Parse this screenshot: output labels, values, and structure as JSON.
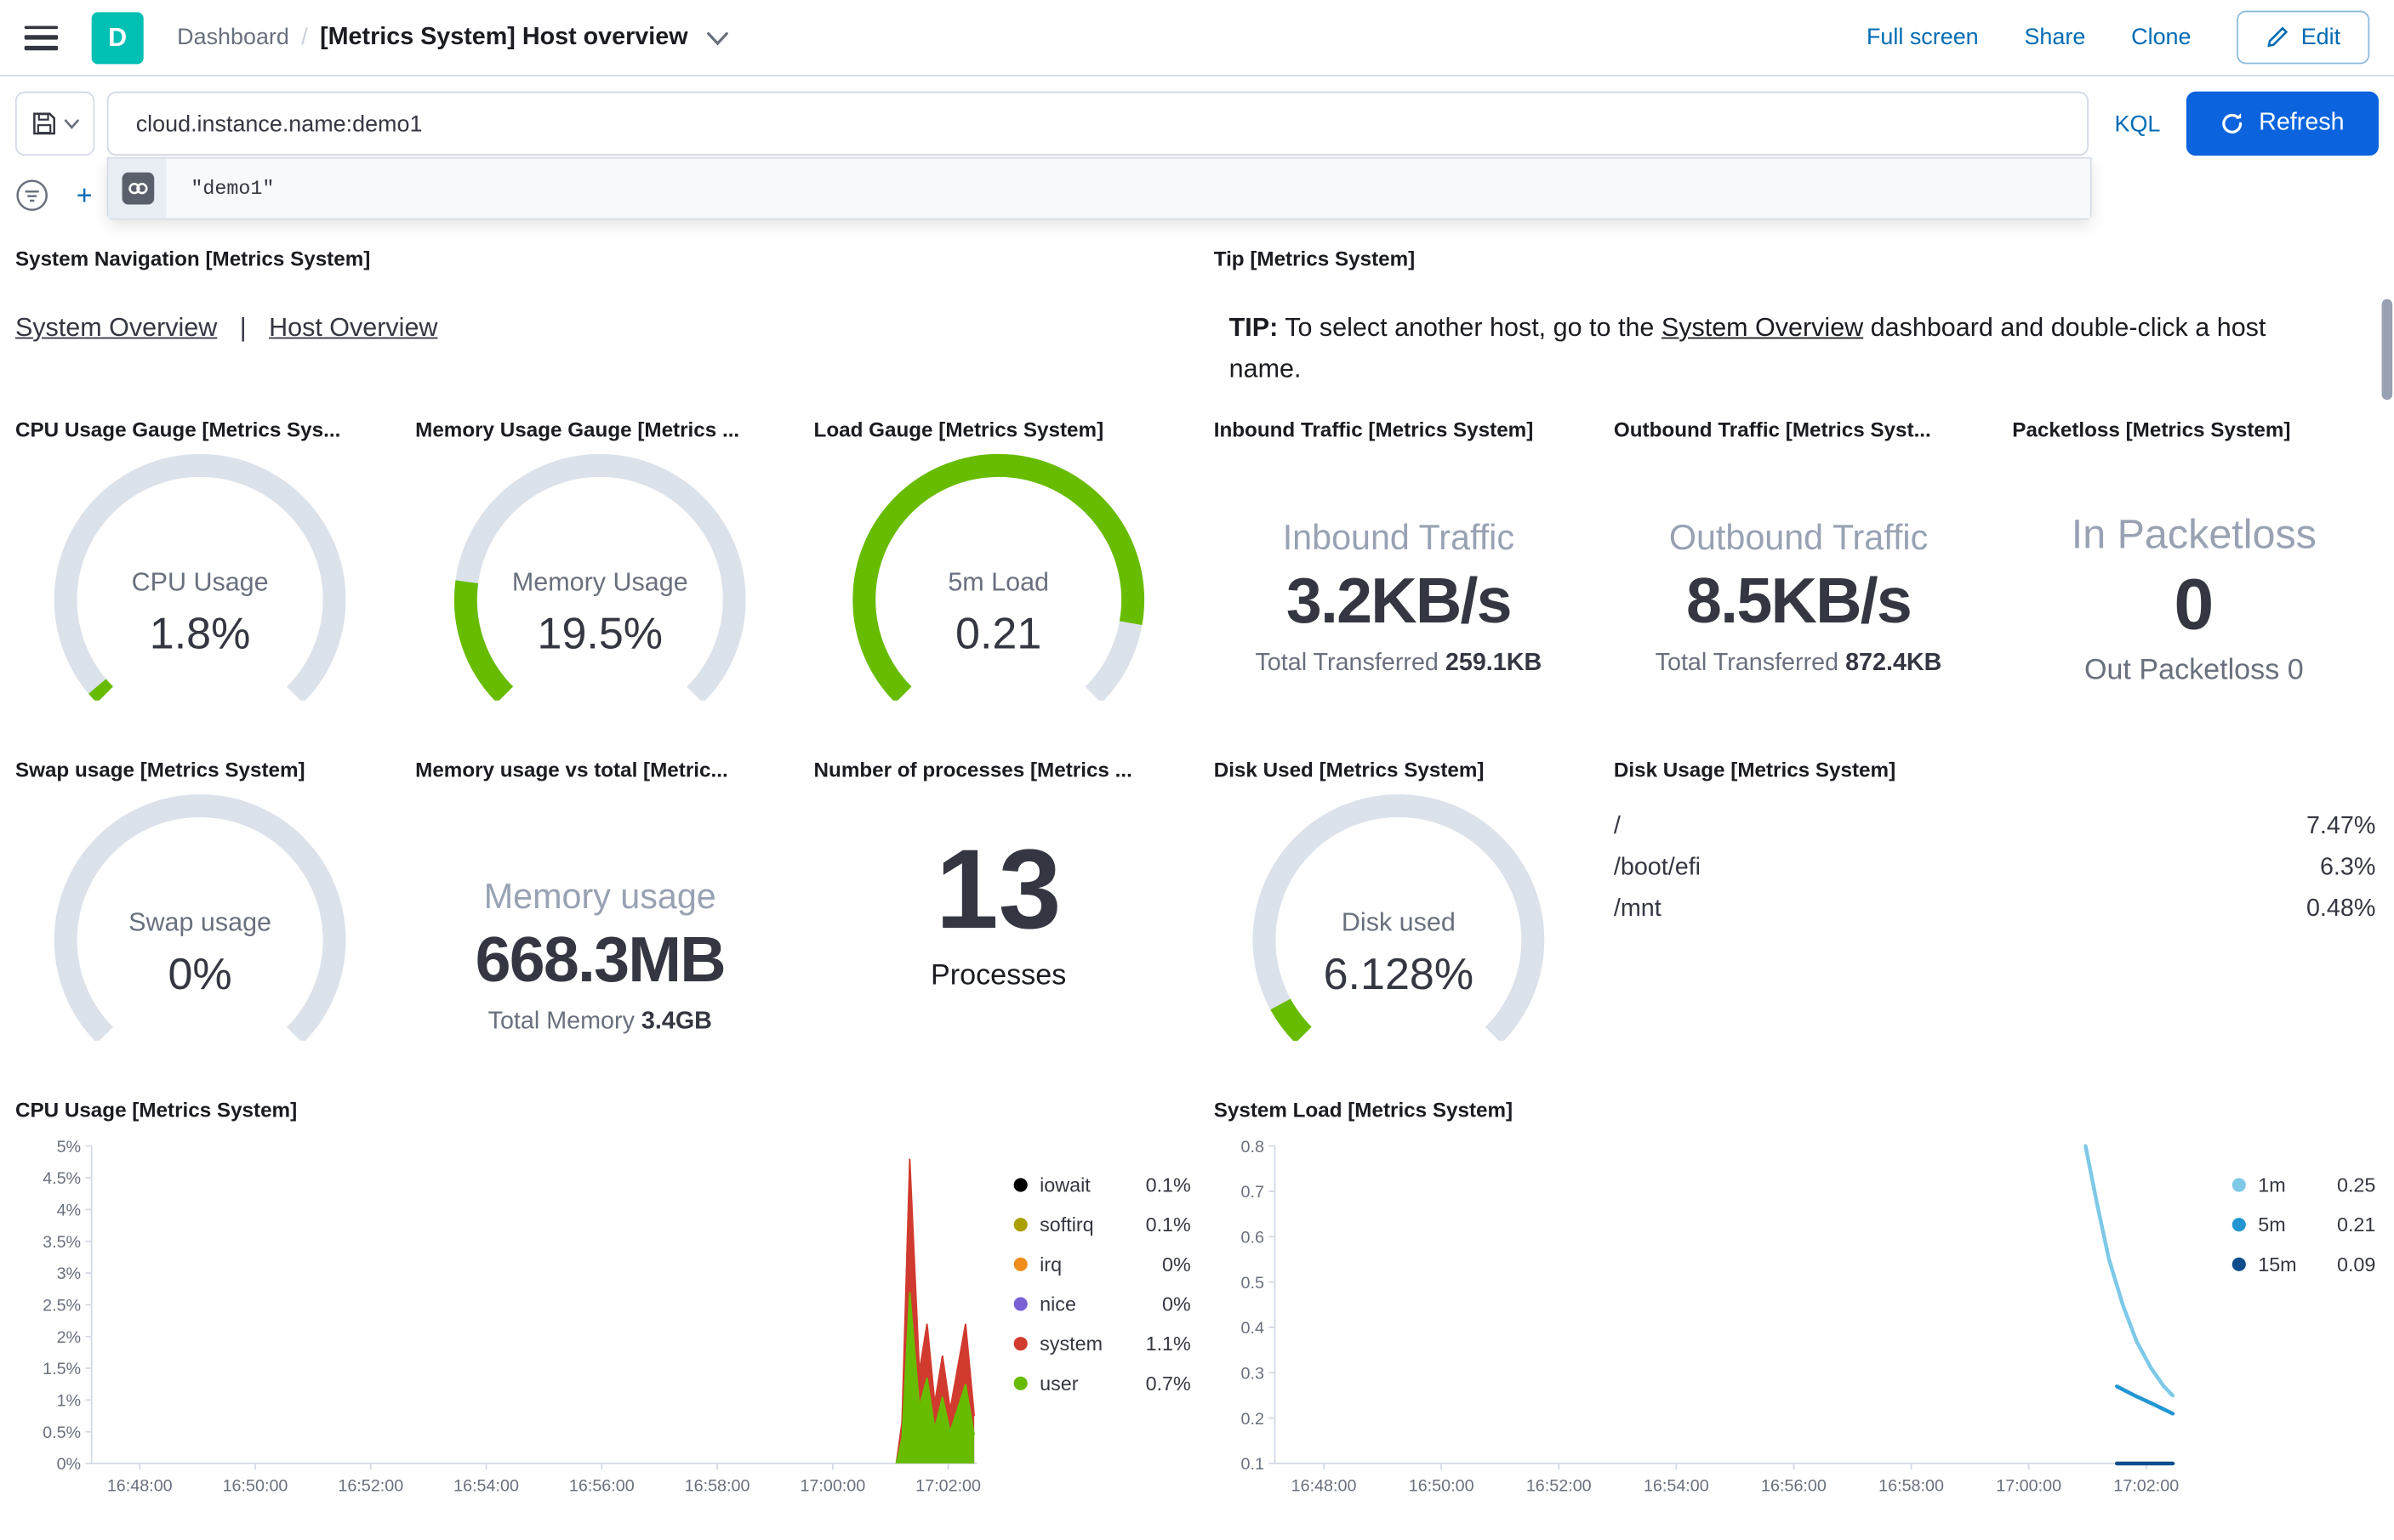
{
  "colors": {
    "primary_button": "#0B64DD",
    "link_blue": "#006BB4",
    "green": "#68BC00",
    "red": "#D13A2E",
    "logo_teal": "#00BFB3",
    "gauge_track": "#DCE2EA"
  },
  "header": {
    "logo_letter": "D",
    "breadcrumb_root": "Dashboard",
    "title": "[Metrics System] Host overview",
    "actions": [
      "Full screen",
      "Share",
      "Clone"
    ],
    "edit_label": "Edit"
  },
  "query_bar": {
    "query": "cloud.instance.name:demo1",
    "language": "KQL",
    "refresh_label": "Refresh",
    "suggestion": "\"demo1\""
  },
  "panels": {
    "sysnav": {
      "title": "System Navigation [Metrics System]",
      "links": [
        "System Overview",
        "Host Overview"
      ],
      "separator": "|"
    },
    "tip": {
      "title": "Tip [Metrics System]",
      "bold": "TIP:",
      "pre": " To select another host, go to the ",
      "link": "System Overview",
      "post": " dashboard and double-click a host name."
    },
    "cpu_gauge": {
      "title": "CPU Usage Gauge [Metrics Sys..."
    },
    "mem_gauge": {
      "title": "Memory Usage Gauge [Metrics ..."
    },
    "load_gauge": {
      "title": "Load Gauge [Metrics System]"
    },
    "inbound": {
      "title": "Inbound Traffic [Metrics System]"
    },
    "outbound": {
      "title": "Outbound Traffic [Metrics Syst..."
    },
    "packetloss": {
      "title": "Packetloss [Metrics System]"
    },
    "swap": {
      "title": "Swap usage [Metrics System]"
    },
    "memtotal": {
      "title": "Memory usage vs total [Metric..."
    },
    "processes": {
      "title": "Number of processes [Metrics ..."
    },
    "disk_used": {
      "title": "Disk Used [Metrics System]"
    },
    "disk_usage": {
      "title": "Disk Usage [Metrics System]"
    },
    "cpu_chart": {
      "title": "CPU Usage [Metrics System]"
    },
    "load_chart": {
      "title": "System Load [Metrics System]"
    }
  },
  "gauges": [
    {
      "id": "cpu",
      "label": "CPU Usage",
      "value": "1.8%",
      "fraction": 0.018
    },
    {
      "id": "memory",
      "label": "Memory Usage",
      "value": "19.5%",
      "fraction": 0.195
    },
    {
      "id": "load",
      "label": "5m Load",
      "value": "0.21",
      "fraction": 0.87
    },
    {
      "id": "swap",
      "label": "Swap usage",
      "value": "0%",
      "fraction": 0
    },
    {
      "id": "disk",
      "label": "Disk used",
      "value": "6.128%",
      "fraction": 0.061
    }
  ],
  "metrics": {
    "inbound": {
      "title": "Inbound Traffic",
      "value": "3.2KB/s",
      "sub_label": "Total Transferred",
      "sub_value": "259.1KB"
    },
    "outbound": {
      "title": "Outbound Traffic",
      "value": "8.5KB/s",
      "sub_label": "Total Transferred",
      "sub_value": "872.4KB"
    },
    "packetloss": {
      "in_label": "In Packetloss",
      "in_value": "0",
      "out_label": "Out Packetloss",
      "out_value": "0"
    },
    "memtotal": {
      "title": "Memory usage",
      "value": "668.3MB",
      "sub_label": "Total Memory",
      "sub_value": "3.4GB"
    },
    "processes": {
      "value": "13",
      "label": "Processes"
    }
  },
  "disk_usage": {
    "max": 7.47,
    "rows": [
      {
        "label": "/",
        "value": 7.47,
        "pct": "7.47%"
      },
      {
        "label": "/boot/efi",
        "value": 6.3,
        "pct": "6.3%"
      },
      {
        "label": "/mnt",
        "value": 0.48,
        "pct": "0.48%"
      }
    ]
  },
  "chart_data": [
    {
      "type": "area",
      "title": "CPU Usage [Metrics System]",
      "stacked": true,
      "x_domain": [
        "16:47:10",
        "17:02:30"
      ],
      "x_ticks": [
        "16:48:00",
        "16:50:00",
        "16:52:00",
        "16:54:00",
        "16:56:00",
        "16:58:00",
        "17:00:00",
        "17:02:00"
      ],
      "ylim": [
        0,
        5
      ],
      "y_ticks": [
        0,
        0.5,
        1,
        1.5,
        2,
        2.5,
        3,
        3.5,
        4,
        4.5,
        5
      ],
      "y_suffix": "%",
      "x": [
        "17:01:06",
        "17:01:12",
        "17:01:20",
        "17:01:30",
        "17:01:38",
        "17:01:46",
        "17:01:54",
        "17:02:02",
        "17:02:18",
        "17:02:27"
      ],
      "series": [
        {
          "name": "user",
          "color": "#68BC00",
          "values": [
            0,
            0.4,
            2.7,
            0.9,
            1.35,
            0.55,
            1.05,
            0.5,
            1.25,
            0.45
          ]
        },
        {
          "name": "system",
          "color": "#D13A2E",
          "values": [
            0,
            0.25,
            2.1,
            0.55,
            0.85,
            0.4,
            0.65,
            0.35,
            0.95,
            0.3
          ]
        }
      ],
      "legend": [
        {
          "label": "iowait",
          "value": "0.1%",
          "color": "#000000"
        },
        {
          "label": "softirq",
          "value": "0.1%",
          "color": "#ABA000"
        },
        {
          "label": "irq",
          "value": "0%",
          "color": "#EF8E1C"
        },
        {
          "label": "nice",
          "value": "0%",
          "color": "#7B61D6"
        },
        {
          "label": "system",
          "value": "1.1%",
          "color": "#D13A2E"
        },
        {
          "label": "user",
          "value": "0.7%",
          "color": "#68BC00"
        }
      ]
    },
    {
      "type": "line",
      "title": "System Load [Metrics System]",
      "stacked": false,
      "x_domain": [
        "16:47:10",
        "17:02:30"
      ],
      "x_ticks": [
        "16:48:00",
        "16:50:00",
        "16:52:00",
        "16:54:00",
        "16:56:00",
        "16:58:00",
        "17:00:00",
        "17:02:00"
      ],
      "ylim": [
        0.1,
        0.8
      ],
      "y_ticks": [
        0.1,
        0.2,
        0.3,
        0.4,
        0.5,
        0.6,
        0.7,
        0.8
      ],
      "y_suffix": "",
      "series": [
        {
          "name": "1m",
          "color": "#7DC9E7",
          "points": [
            [
              "17:00:58",
              0.84
            ],
            [
              "17:01:10",
              0.67
            ],
            [
              "17:01:22",
              0.55
            ],
            [
              "17:01:36",
              0.45
            ],
            [
              "17:01:50",
              0.37
            ],
            [
              "17:02:05",
              0.31
            ],
            [
              "17:02:18",
              0.27
            ],
            [
              "17:02:27",
              0.25
            ]
          ]
        },
        {
          "name": "5m",
          "color": "#2196D2",
          "points": [
            [
              "17:01:30",
              0.27
            ],
            [
              "17:01:48",
              0.25
            ],
            [
              "17:02:08",
              0.23
            ],
            [
              "17:02:27",
              0.21
            ]
          ]
        },
        {
          "name": "15m",
          "color": "#0F4C8C",
          "points": [
            [
              "17:01:30",
              0.1
            ],
            [
              "17:02:00",
              0.1
            ],
            [
              "17:02:04",
              0.09
            ],
            [
              "17:02:27",
              0.09
            ]
          ]
        }
      ],
      "legend": [
        {
          "label": "1m",
          "value": "0.25",
          "color": "#7DC9E7"
        },
        {
          "label": "5m",
          "value": "0.21",
          "color": "#2196D2"
        },
        {
          "label": "15m",
          "value": "0.09",
          "color": "#0F4C8C"
        }
      ]
    }
  ]
}
